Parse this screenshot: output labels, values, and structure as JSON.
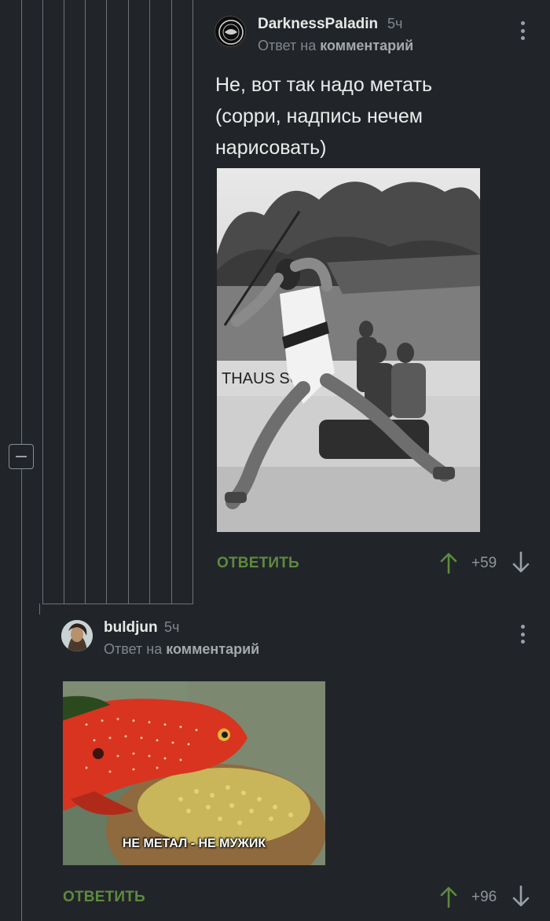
{
  "comments": [
    {
      "author": "DarknessPaladin",
      "time": "5ч",
      "reply_prefix": "Ответ на",
      "reply_target": "комментарий",
      "text_lines": [
        "Не, вот так надо метать",
        "(сорри, надпись нечем",
        "нарисовать)"
      ],
      "image_alt": "Javelin thrower photo",
      "reply_label": "ОТВЕТИТЬ",
      "rating": "+59"
    },
    {
      "author": "buldjun",
      "time": "5ч",
      "reply_prefix": "Ответ на",
      "reply_target": "комментарий",
      "image_caption": "НЕ МЕТАЛ - НЕ МУЖИК",
      "reply_label": "ОТВЕТИТЬ",
      "rating": "+96"
    }
  ],
  "colors": {
    "background": "#212529",
    "accent_green": "#5e8a3f",
    "muted": "#80868c"
  },
  "icons": [
    "collapse-icon",
    "more-icon",
    "arrow-up-icon",
    "arrow-down-icon"
  ]
}
